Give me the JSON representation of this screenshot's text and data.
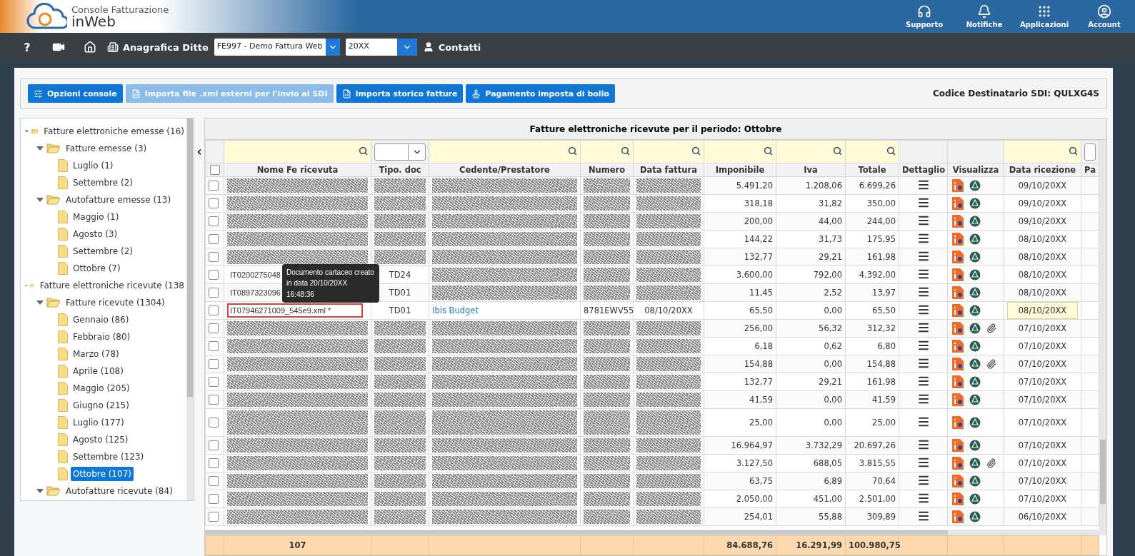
{
  "app": {
    "title": "Console Fatturazione",
    "subtitle": "inWeb"
  },
  "header_actions": [
    {
      "label": "Supporto",
      "kind": "headphones"
    },
    {
      "label": "Notifiche",
      "kind": "bell"
    },
    {
      "label": "Applicazioni",
      "kind": "grid"
    },
    {
      "label": "Account",
      "kind": "account"
    }
  ],
  "navbar": {
    "help": "?",
    "company_label": "Anagrafica Ditte",
    "company": "FE997 - Demo Fattura Web",
    "year": "20XX",
    "contacts": "Contatti"
  },
  "toolbar": {
    "buttons": [
      {
        "label": "Opzioni console",
        "kind": "options",
        "disabled": false
      },
      {
        "label": "Importa file .xml esterni per l'invio al SDI",
        "kind": "file",
        "disabled": true
      },
      {
        "label": "Importa storico fatture",
        "kind": "file",
        "disabled": false
      },
      {
        "label": "Pagamento imposta di bollo",
        "kind": "stamp",
        "disabled": false
      }
    ],
    "sdi_code": "Codice Destinatario SDI: QULXG4S"
  },
  "tree": [
    {
      "label": "Fatture elettroniche emesse (16)",
      "expanded": true,
      "selected": false,
      "children": [
        {
          "label": "Fatture emesse (3)",
          "expanded": true,
          "selected": false,
          "children": [
            {
              "label": "Luglio (1)",
              "selected": false
            },
            {
              "label": "Settembre (2)",
              "selected": false
            }
          ]
        },
        {
          "label": "Autofatture emesse (13)",
          "expanded": true,
          "selected": false,
          "children": [
            {
              "label": "Maggio (1)",
              "selected": false
            },
            {
              "label": "Agosto (3)",
              "selected": false
            },
            {
              "label": "Settembre (2)",
              "selected": false
            },
            {
              "label": "Ottobre (7)",
              "selected": false
            }
          ]
        }
      ]
    },
    {
      "label": "Fatture elettroniche ricevute (138",
      "expanded": true,
      "selected": false,
      "children": [
        {
          "label": "Fatture ricevute (1304)",
          "expanded": true,
          "selected": false,
          "children": [
            {
              "label": "Gennaio (86)",
              "selected": false
            },
            {
              "label": "Febbraio (80)",
              "selected": false
            },
            {
              "label": "Marzo (78)",
              "selected": false
            },
            {
              "label": "Aprile (108)",
              "selected": false
            },
            {
              "label": "Maggio (205)",
              "selected": false
            },
            {
              "label": "Giugno (215)",
              "selected": false
            },
            {
              "label": "Luglio (177)",
              "selected": false
            },
            {
              "label": "Agosto (125)",
              "selected": false
            },
            {
              "label": "Settembre (123)",
              "selected": false
            },
            {
              "label": "Ottobre (107)",
              "selected": true
            }
          ]
        },
        {
          "label": "Autofatture ricevute (84)",
          "expanded": true,
          "selected": false
        }
      ]
    }
  ],
  "table": {
    "title": "Fatture elettroniche ricevute per il periodo: Ottobre",
    "select_all": false,
    "columns": [
      {
        "label": "Nome Fe ricevuta",
        "kind": "search"
      },
      {
        "label": "Tipo. doc",
        "kind": "select"
      },
      {
        "label": "Cedente/Prestatore",
        "kind": "search"
      },
      {
        "label": "Numero",
        "kind": "search"
      },
      {
        "label": "Data fattura",
        "kind": "search"
      },
      {
        "label": "Imponibile",
        "kind": "search"
      },
      {
        "label": "Iva",
        "kind": "search"
      },
      {
        "label": "Totale",
        "kind": "search"
      },
      {
        "label": "Dettaglio",
        "kind": "none"
      },
      {
        "label": "Visualizza",
        "kind": "none"
      },
      {
        "label": "Data ricezione",
        "kind": "search"
      },
      {
        "label": "Pa",
        "kind": "input"
      }
    ],
    "rows": [
      {
        "checked": false,
        "imponibile": "5.491,20",
        "iva": "1.208,06",
        "totale": "6.699,26",
        "data_ricezione": "09/10/20XX",
        "attachment": false
      },
      {
        "checked": false,
        "imponibile": "318,18",
        "iva": "31,82",
        "totale": "350,00",
        "data_ricezione": "09/10/20XX",
        "attachment": false
      },
      {
        "checked": false,
        "imponibile": "200,00",
        "iva": "44,00",
        "totale": "244,00",
        "data_ricezione": "09/10/20XX",
        "attachment": false
      },
      {
        "checked": false,
        "imponibile": "144,22",
        "iva": "31,73",
        "totale": "175,95",
        "data_ricezione": "08/10/20XX",
        "attachment": false
      },
      {
        "checked": false,
        "imponibile": "132,77",
        "iva": "29,21",
        "totale": "161,98",
        "data_ricezione": "08/10/20XX",
        "attachment": false
      },
      {
        "checked": false,
        "nome": "IT0200275048",
        "tipo": "TD24",
        "imponibile": "3.600,00",
        "iva": "792,00",
        "totale": "4.392,00",
        "data_ricezione": "08/10/20XX",
        "attachment": false
      },
      {
        "checked": false,
        "nome": "IT0897323096",
        "tipo": "TD01",
        "imponibile": "11,45",
        "iva": "2,52",
        "totale": "13,97",
        "data_ricezione": "08/10/20XX",
        "attachment": false
      },
      {
        "checked": false,
        "nome": "IT07946271009_545e9.xml *",
        "tipo": "TD01",
        "cedente": "Ibis Budget",
        "numero": "8781EWV55",
        "data_fattura": "08/10/20XX",
        "imponibile": "65,50",
        "iva": "0,00",
        "totale": "65,50",
        "data_ricezione": "08/10/20XX",
        "attachment": false,
        "highlighted": true,
        "focused": true
      },
      {
        "checked": false,
        "imponibile": "256,00",
        "iva": "56,32",
        "totale": "312,32",
        "data_ricezione": "07/10/20XX",
        "attachment": true
      },
      {
        "checked": false,
        "imponibile": "6,18",
        "iva": "0,62",
        "totale": "6,80",
        "data_ricezione": "07/10/20XX",
        "attachment": false
      },
      {
        "checked": false,
        "imponibile": "154,88",
        "iva": "0,00",
        "totale": "154,88",
        "data_ricezione": "07/10/20XX",
        "attachment": true
      },
      {
        "checked": false,
        "imponibile": "132,77",
        "iva": "29,21",
        "totale": "161,98",
        "data_ricezione": "07/10/20XX",
        "attachment": false
      },
      {
        "checked": false,
        "imponibile": "41,59",
        "iva": "0,00",
        "totale": "41,59",
        "data_ricezione": "07/10/20XX",
        "attachment": false
      },
      {
        "checked": false,
        "imponibile": "25,00",
        "iva": "0,00",
        "totale": "25,00",
        "data_ricezione": "07/10/20XX",
        "attachment": false,
        "tall": true
      },
      {
        "checked": false,
        "imponibile": "16.964,97",
        "iva": "3.732,29",
        "totale": "20.697,26",
        "data_ricezione": "07/10/20XX",
        "attachment": false
      },
      {
        "checked": false,
        "imponibile": "3.127,50",
        "iva": "688,05",
        "totale": "3.815,55",
        "data_ricezione": "07/10/20XX",
        "attachment": true
      },
      {
        "checked": false,
        "imponibile": "63,75",
        "iva": "6,89",
        "totale": "70,64",
        "data_ricezione": "07/10/20XX",
        "attachment": false
      },
      {
        "checked": false,
        "imponibile": "2.050,00",
        "iva": "451,00",
        "totale": "2.501,00",
        "data_ricezione": "07/10/20XX",
        "attachment": false
      },
      {
        "checked": false,
        "imponibile": "254,01",
        "iva": "55,88",
        "totale": "309,89",
        "data_ricezione": "06/10/20XX",
        "attachment": false
      }
    ],
    "footer": {
      "count": "107",
      "imponibile": "84.688,76",
      "iva": "16.291,99",
      "totale": "100.980,75"
    },
    "tooltip": "Documento cartaceo creato in data 20/10/20XX 16:48:36"
  }
}
